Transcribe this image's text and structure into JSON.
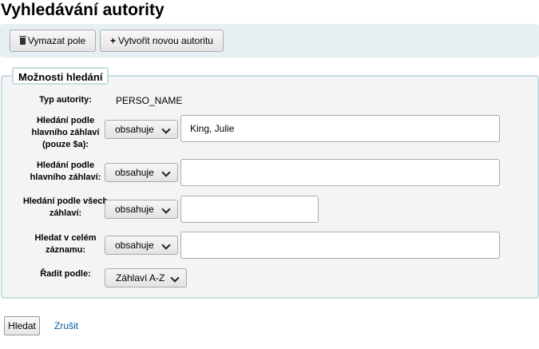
{
  "page": {
    "title": "Vyhledávání autority"
  },
  "toolbar": {
    "clear_label": "Vymazat pole",
    "create_label": "Vytvořit novou autoritu"
  },
  "options": {
    "legend": "Možnosti hledání",
    "authority_type": {
      "label": "Typ autority:",
      "value": "PERSO_NAME"
    },
    "main_heading_a": {
      "label": "Hledání podle hlavního záhlaví (pouze $a):",
      "operator": "obsahuje",
      "value": "King, Julie"
    },
    "main_heading": {
      "label": "Hledání podle hlavního záhlaví:",
      "operator": "obsahuje",
      "value": ""
    },
    "all_headings": {
      "label": "Hledání podle všech záhlaví:",
      "operator": "obsahuje",
      "value": ""
    },
    "entire_record": {
      "label": "Hledat v celém záznamu:",
      "operator": "obsahuje",
      "value": ""
    },
    "sort": {
      "label": "Řadit podle:",
      "value": "Záhlaví A-Z"
    }
  },
  "actions": {
    "search_label": "Hledat",
    "cancel_label": "Zrušit"
  }
}
